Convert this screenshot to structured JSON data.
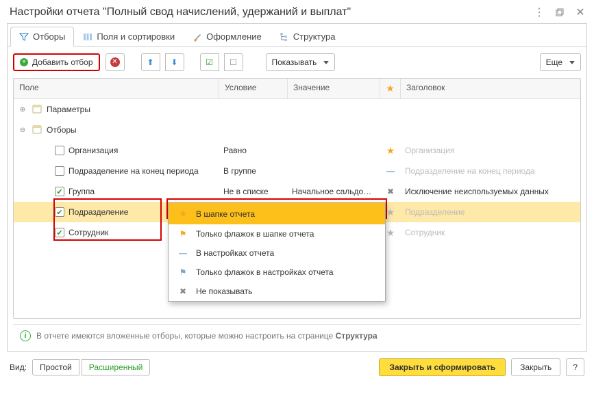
{
  "window": {
    "title": "Настройки отчета \"Полный свод начислений, удержаний и выплат\""
  },
  "tabs": [
    {
      "label": "Отборы",
      "active": true,
      "icon": "filter"
    },
    {
      "label": "Поля и сортировки",
      "active": false,
      "icon": "columns"
    },
    {
      "label": "Оформление",
      "active": false,
      "icon": "brush"
    },
    {
      "label": "Структура",
      "active": false,
      "icon": "tree"
    }
  ],
  "toolbar": {
    "add_filter": "Добавить отбор",
    "show": "Показывать",
    "more": "Еще"
  },
  "columns": {
    "field": "Поле",
    "condition": "Условие",
    "value": "Значение",
    "star": "★",
    "header": "Заголовок"
  },
  "tree": {
    "params_label": "Параметры",
    "filters_label": "Отборы"
  },
  "rows": [
    {
      "checked": false,
      "checkbox": true,
      "label": "Организация",
      "condition": "Равно",
      "value": "",
      "star": "star",
      "header": "Организация",
      "muted": true
    },
    {
      "checked": false,
      "checkbox": true,
      "label": "Подразделение на конец периода",
      "condition": "В группе",
      "value": "",
      "star": "dash",
      "header": "Подразделение на конец периода",
      "muted": true
    },
    {
      "checked": true,
      "checkbox": true,
      "label": "Группа",
      "condition": "Не в списке",
      "value": "Начальное сальдо…",
      "star": "x",
      "header": "Исключение неиспользуемых данных",
      "muted": false
    },
    {
      "checked": true,
      "checkbox": true,
      "label": "Подразделение",
      "condition": "",
      "value": "",
      "star": "star-grey",
      "header": "Подразделение",
      "muted": true,
      "highlight": true
    },
    {
      "checked": true,
      "checkbox": true,
      "label": "Сотрудник",
      "condition": "",
      "value": "",
      "star": "star-grey",
      "header": "Сотрудник",
      "muted": true
    }
  ],
  "dropdown": {
    "items": [
      {
        "icon": "star",
        "label": "В шапке отчета",
        "selected": true
      },
      {
        "icon": "flag",
        "label": "Только флажок в шапке отчета"
      },
      {
        "icon": "dash",
        "label": "В настройках отчета"
      },
      {
        "icon": "flag-dash",
        "label": "Только флажок в настройках отчета"
      },
      {
        "icon": "x",
        "label": "Не показывать"
      }
    ]
  },
  "info": {
    "text_before": "В отчете имеются вложенные отборы, которые можно настроить на странице ",
    "link": "Структура"
  },
  "footer": {
    "view_label": "Вид:",
    "mode_simple": "Простой",
    "mode_ext": "Расширенный",
    "primary": "Закрыть и сформировать",
    "close": "Закрыть",
    "help": "?"
  }
}
